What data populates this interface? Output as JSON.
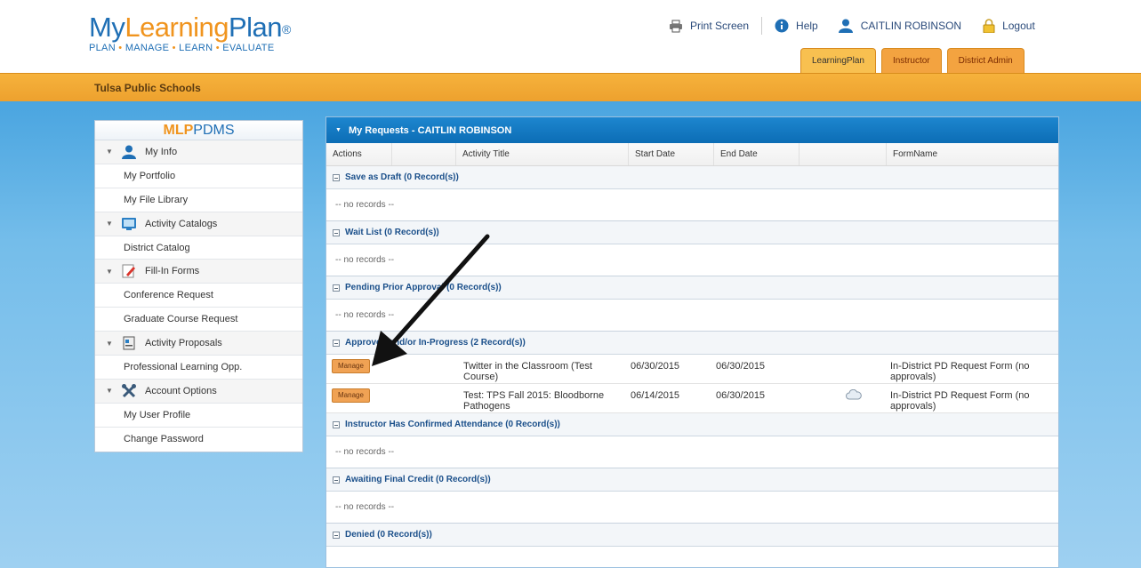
{
  "header": {
    "logo": {
      "my": "My",
      "learning": "Learning",
      "plan": "Plan",
      "reg": "®",
      "tagline": [
        "PLAN",
        "MANAGE",
        "LEARN",
        "EVALUATE"
      ],
      "sep": "•"
    },
    "links": {
      "print_screen": "Print Screen",
      "help": "Help",
      "user": "CAITLIN ROBINSON",
      "logout": "Logout"
    },
    "tabs": [
      {
        "label": "LearningPlan",
        "active": true
      },
      {
        "label": "Instructor",
        "active": false
      },
      {
        "label": "District Admin",
        "active": false
      }
    ]
  },
  "school_bar": {
    "label": "Tulsa Public Schools"
  },
  "sidebar": {
    "title_mlp": "MLP",
    "title_pdms": "PDMS",
    "sections": [
      {
        "label": "My Info",
        "icon": "user-icon",
        "items": [
          "My Portfolio",
          "My File Library"
        ]
      },
      {
        "label": "Activity Catalogs",
        "icon": "monitor-icon",
        "items": [
          "District Catalog"
        ]
      },
      {
        "label": "Fill-In Forms",
        "icon": "pencil-form-icon",
        "items": [
          "Conference Request",
          "Graduate Course Request"
        ]
      },
      {
        "label": "Activity Proposals",
        "icon": "proposal-doc-icon",
        "items": [
          "Professional Learning Opp."
        ]
      },
      {
        "label": "Account Options",
        "icon": "tools-icon",
        "items": [
          "My User Profile",
          "Change Password"
        ]
      }
    ]
  },
  "main": {
    "title": "My Requests - CAITLIN ROBINSON",
    "columns": [
      "Actions",
      "Activity Title",
      "Start Date",
      "End Date",
      "",
      "FormName"
    ],
    "no_records": "-- no records --",
    "groups": {
      "save_draft": "Save as Draft (0 Record(s))",
      "wait_list": "Wait List (0 Record(s))",
      "pending": "Pending Prior Approval (0 Record(s))",
      "approved": "Approved and/or In-Progress (2 Record(s))",
      "instructor_confirmed": "Instructor Has Confirmed Attendance (0 Record(s))",
      "awaiting_credit": "Awaiting Final Credit (0 Record(s))",
      "denied": "Denied (0 Record(s))"
    },
    "records": [
      {
        "action": "Manage",
        "title": "Twitter in the Classroom (Test Course)",
        "start": "06/30/2015",
        "end": "06/30/2015",
        "form": "In-District PD Request Form (no approvals)",
        "has_icon": false
      },
      {
        "action": "Manage",
        "title": "Test: TPS Fall 2015: Bloodborne Pathogens",
        "start": "06/14/2015",
        "end": "06/30/2015",
        "form": "In-District PD Request Form (no approvals)",
        "has_icon": true
      }
    ]
  },
  "colors": {
    "brand_blue": "#1f6fb5",
    "brand_orange": "#f0941e",
    "panel_header": "#1479c4",
    "manage_button": "#f0a254"
  },
  "annotation": "black-arrow-pointing-to-approved-group"
}
